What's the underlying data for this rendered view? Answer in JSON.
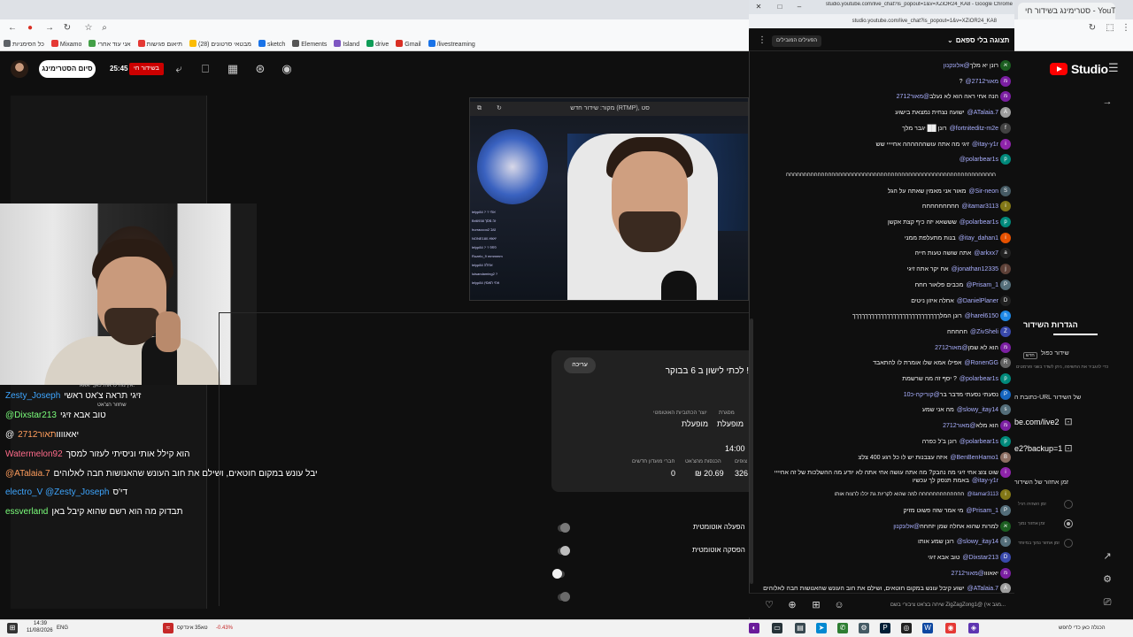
{
  "browser": {
    "tabs": [
      {
        "label": "סטרימינג בשידור חי - YouTube Studio"
      },
      {
        "label": "Google Chrome"
      }
    ],
    "bookmarks": [
      {
        "label": "כל הסימניות",
        "color": "#5f6368"
      },
      {
        "label": "Mixamo",
        "color": "#e53935"
      },
      {
        "label": "אני עוד אחרי",
        "color": "#43a047"
      },
      {
        "label": "תיאום פגישות",
        "color": "#e53935"
      },
      {
        "label": "מבטאי סרטונים (28)",
        "color": "#fbbc04"
      },
      {
        "label": "sketch",
        "color": "#1a73e8"
      },
      {
        "label": "Elements",
        "color": "#555555"
      },
      {
        "label": "Island",
        "color": "#7e57c2"
      },
      {
        "label": "drive",
        "color": "#0f9d58"
      },
      {
        "label": "Gmail",
        "color": "#d93025"
      },
      {
        "label": "/livestreaming",
        "color": "#1a73e8"
      }
    ]
  },
  "studio": {
    "end_stream": "סיום הסטרימינג",
    "timer": "25:45",
    "live_badge": "בשידור חי",
    "logo_text": "Studio",
    "header_icons": [
      "share-icon",
      "bookmark-icon",
      "clapper-icon",
      "tune-icon",
      "broadcast-icon"
    ]
  },
  "overlay_chat": {
    "caption": "אין מה לראות כאן, יאאא.",
    "lines": [
      {
        "user": "Zesty_Joseph",
        "user_color": "#3ea6ff",
        "text": "זיגי תראה צ'אט ראשי",
        "sub": "שחזור הצ'אט"
      },
      {
        "user": "@Dixstar213",
        "user_color": "#7bff7b",
        "text": "טוב אבא זיגי"
      },
      {
        "user": "@יאאוווו",
        "user_color": "#ffffff",
        "text": "תאור2712",
        "text_color": "#ff9d5c"
      },
      {
        "user": "Watermelon92",
        "user_color": "#ff6b8a",
        "text": "הוא קילל אותי וניסיתי לעזור למסך"
      },
      {
        "user": "@ATalaia.7",
        "user_color": "#ff9d5c",
        "text": "יבל עונש במקום חוטאים, ושילם את חוב העונש שהאנושות חבה לאלוהים"
      },
      {
        "user": "electro_V @Zesty_Joseph",
        "user_color": "#3ea6ff",
        "text": "די'ס"
      },
      {
        "user": "essverland",
        "user_color": "#7bff7b",
        "text": "תבדוק מה הוא רשם שהוא קיבל באן"
      }
    ]
  },
  "preview": {
    "bar_text": "מקור: שידור חדש (RTMP), סט",
    "mini_chat": [
      "lelyp84 ? ‎?‎ אחי",
      "Bri6938 זה מסך",
      "hurraccoo2 טוב",
      "NONE180 יאאא",
      "lelyp84 ‎?‎ ‎?‎ פפפ",
      "Ruzelo_9 mmmmm",
      "lelyp84 אחלה",
      "luisandaming2 ?",
      "lelyp84 אחי תאמין"
    ]
  },
  "stats": {
    "edit": "עריכה",
    "title": "לכתי לישון ב 6 בבוקר !",
    "items": [
      {
        "label": "מסגרת",
        "value": "מופעלת"
      },
      {
        "label": "יוצר הכתוביות האוטומטי",
        "value": "מופעלת"
      },
      {
        "label": "זמן",
        "value": "14:00"
      },
      {
        "label": "צופים",
        "value": "326"
      },
      {
        "label": "הכנסות מהצ'אט",
        "value": "₪ 20.69"
      },
      {
        "label": "חברי מועדון חדשים",
        "value": "0"
      }
    ],
    "toggles": [
      {
        "label": "הפעלה אוטומטית",
        "state": "off"
      },
      {
        "label": "הפסקה אוטומטית",
        "state": "on"
      },
      {
        "label": "",
        "state": "on"
      },
      {
        "label": "",
        "state": "off"
      }
    ]
  },
  "right_panel": {
    "title": "הגדרות השידור",
    "line1": "שידור כפול",
    "badge": "חדש",
    "desc": "כדי להגביר את החשיפה, ניתן לשדר בשני פורמטים",
    "url_label": "כתובת ה-URL של השידור",
    "url1": "be.com/live2",
    "url2": "e2?backup=1",
    "delay_label": "זמן אחזור של השידור",
    "opt1": "זמן השהיה רגיל",
    "opt2": "זמן אחזור נמוך",
    "opt3": "זמן אחזור נמוך במיוחד"
  },
  "popout": {
    "title": "studio.youtube.com/live_chat?is_popout=1&v=XZiOR24_KA8 - Google Chrome",
    "url": "studio.youtube.com/live_chat?is_popout=1&v=XZiOR24_KA8",
    "mode": "תצוגה בלי ספאם",
    "badge": "הפעילים המובילים",
    "input_placeholder": "שיחה בצ'אט ציבורי בשם ZigZagZong1@ (מגב אי...",
    "messages": [
      {
        "user": "@אלונקנון",
        "text": "רונן יא מלך",
        "av": "א",
        "avc": "#1b5e20"
      },
      {
        "user": "@מאור2712",
        "text": "?",
        "av": "מ",
        "avc": "#7b1fa2"
      },
      {
        "user": "@מאור2712",
        "text": "הנה אחי ראה הוא לא נעלב",
        "av": "מ",
        "avc": "#7b1fa2"
      },
      {
        "user": "@ATalaia.7",
        "text": "ישועה נצחית נמצאת בישוע",
        "av": "A",
        "avc": "#9e9e9e"
      },
      {
        "user": "@fortniteditz-m2e",
        "text": "רונן ██ יגבר מלך",
        "av": "f",
        "avc": "#424242"
      },
      {
        "user": "@itay-y1r",
        "text": "זיגי מה אתה עושהההההה אחיייי שש",
        "av": "i",
        "avc": "#8e24aa"
      },
      {
        "user": "@polarbear1s",
        "text": "",
        "av": "p",
        "avc": "#00897b"
      },
      {
        "user": "",
        "text": "חחחחחחחחחחחחחחחחחחחחחחחחחחחחחחחחחחחחחחחחחחחחחחחחחחחחחחחחחחחח",
        "av": "",
        "avc": ""
      },
      {
        "user": "@Sir-neon",
        "text": "מאור אני מאמין שאתה על הגל",
        "av": "S",
        "avc": "#455a64"
      },
      {
        "user": "@itamar3113",
        "text": "חחחחחחחחח",
        "av": "i",
        "avc": "#827717"
      },
      {
        "user": "@polarbear1s",
        "text": "שששאא יזה כיף קצת אקשן",
        "av": "p",
        "avc": "#00897b"
      },
      {
        "user": "@itay_dahan1",
        "text": "בנות מתעלפת ממני",
        "av": "i",
        "avc": "#e65100"
      },
      {
        "user": "@arkxx7",
        "text": "אתה שושה טעות חייה",
        "av": "a",
        "avc": "#212121"
      },
      {
        "user": "@jonathan12335",
        "text": "אח יקר אתה זיגי",
        "av": "j",
        "avc": "#5d4037"
      },
      {
        "user": "@Prisam_1",
        "text": "מכבים פלאור חחח",
        "av": "P",
        "avc": "#546e7a"
      },
      {
        "user": "@DanielPlaner",
        "text": "אחלה איזון ניטים",
        "av": "D",
        "avc": "#212121"
      },
      {
        "user": "@harel6150",
        "text": "רונן המלךךךךךךךךךךךךךךךךךךךךךךךךךךךך",
        "av": "h",
        "avc": "#1e88e5"
      },
      {
        "user": "@ZivSheli",
        "text": "חחחחח",
        "av": "Z",
        "avc": "#3949ab"
      },
      {
        "user": "@מאור2712",
        "text": "הוא לא שמן",
        "av": "מ",
        "avc": "#7b1fa2"
      },
      {
        "user": "@RonenGG",
        "text": "אפילו אמא שלו אומרת לו להתאבד",
        "av": "R",
        "avc": "#616161"
      },
      {
        "user": "@polarbear1s",
        "text": "יסף זה מה שרשמת ?",
        "av": "p",
        "avc": "#00897b"
      },
      {
        "user": "@קוריקה-כ10",
        "text": "נסעתי נסעתי מדבר בר",
        "av": "P",
        "avc": "#1565c0"
      },
      {
        "user": "@slowy_itay14",
        "text": "מה אני שמע",
        "av": "s",
        "avc": "#546e7a"
      },
      {
        "user": "@מאור2712",
        "text": "הוא מלא",
        "av": "מ",
        "avc": "#7b1fa2"
      },
      {
        "user": "@polarbear1s",
        "text": "רונן ב'ל כפרה",
        "av": "p",
        "avc": "#00897b"
      },
      {
        "user": "@BenBenHamo1",
        "text": "איזה עצבנות יש לו כל רגע 400 צלצ",
        "av": "B",
        "avc": "#8d6e63"
      },
      {
        "user": "@itay-y1r",
        "text": "שוט צוצ אחי זיגי מה נהבק? מה אתה עושה אחי אתה לא יודע מה ההשלכות של זה אחיייי באמת תנסק לך עכשיו",
        "av": "i",
        "avc": "#8e24aa",
        "wrap": true
      },
      {
        "user": "@itamar3113",
        "text": "חחחחחחחחחחחחח למה שהוא לקריות גת יכלו לרצוח אותו",
        "av": "i",
        "avc": "#827717"
      },
      {
        "user": "@Prisam_1",
        "text": "מי אמר שזה פשוט מזיק",
        "av": "P",
        "avc": "#546e7a"
      },
      {
        "user": "@אלונקנון",
        "text": "למרות שהוא אחלה שמן יזחחח",
        "av": "א",
        "avc": "#1b5e20"
      },
      {
        "user": "@slowy_itay14",
        "text": "רונן שמע אותו",
        "av": "s",
        "avc": "#546e7a"
      },
      {
        "user": "@Dixstar213",
        "text": "טוב אבא זיגי",
        "av": "D",
        "avc": "#3949ab"
      },
      {
        "user": "@מאור2712",
        "text": "יאאווו",
        "av": "מ",
        "avc": "#7b1fa2"
      },
      {
        "user": "@ATalaia.7",
        "text": "ישוע קיבל עונש במקום חוטאים, ושילם את חוב העונש שהאנושות חבה לאלוהים",
        "av": "A",
        "avc": "#9e9e9e",
        "wrap": true
      }
    ]
  },
  "taskbar": {
    "time": "14:39",
    "date": "11/08/2026",
    "lang": "ENG",
    "stock": "טא35 אינדקס",
    "stock_change": "-0.43%",
    "weather_text": "הכנלה כאן כדי לחפש"
  }
}
